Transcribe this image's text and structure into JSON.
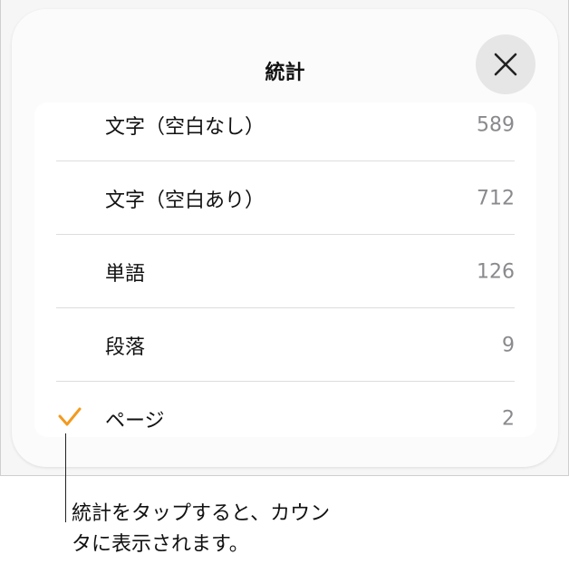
{
  "sheet": {
    "title": "統計",
    "close_icon": "close-icon"
  },
  "stats": {
    "items": [
      {
        "label": "文字（空白なし）",
        "value": "589",
        "selected": false
      },
      {
        "label": "文字（空白あり）",
        "value": "712",
        "selected": false
      },
      {
        "label": "単語",
        "value": "126",
        "selected": false
      },
      {
        "label": "段落",
        "value": "9",
        "selected": false
      },
      {
        "label": "ページ",
        "value": "2",
        "selected": true
      }
    ],
    "check_color": "#f39a1f"
  },
  "callout": {
    "text_line1": "統計をタップすると、カウン",
    "text_line2": "タに表示されます。"
  }
}
